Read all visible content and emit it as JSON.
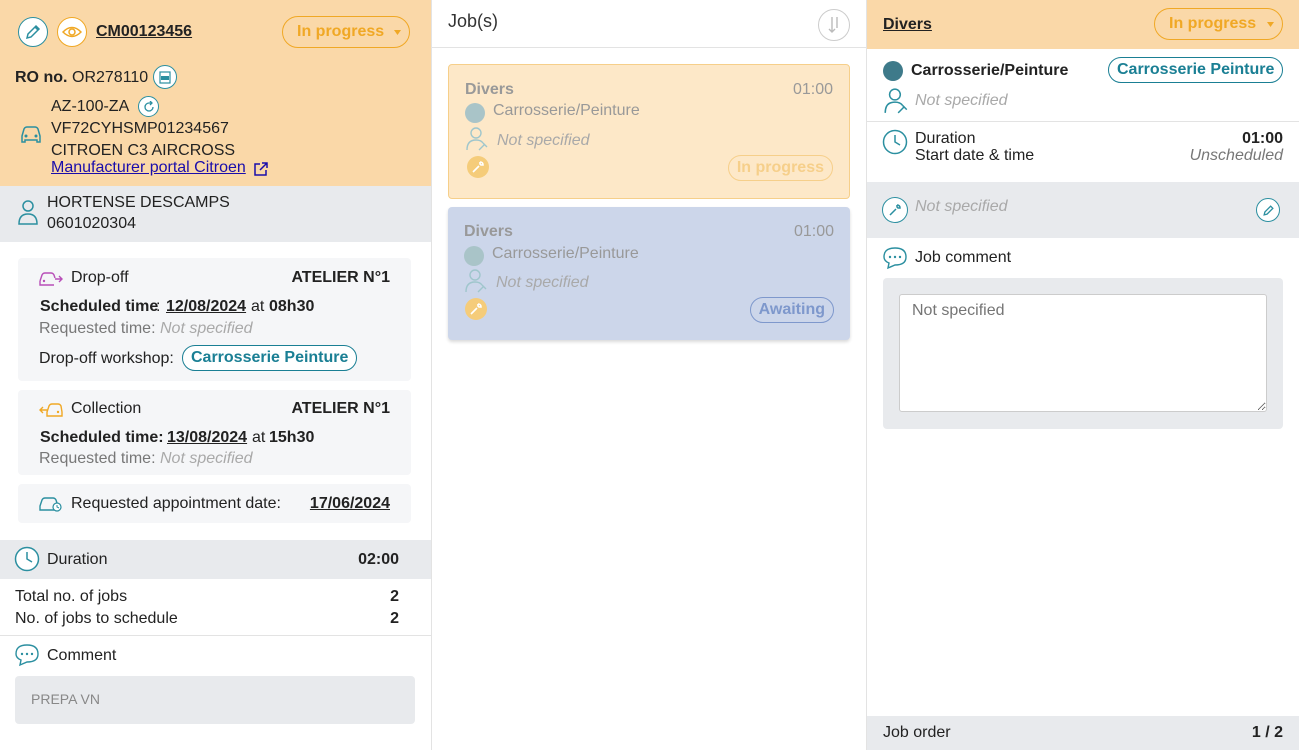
{
  "order": {
    "id": "CM00123456",
    "status": "In progress",
    "ro_label": "RO no.",
    "ro_value": "OR278110",
    "plate": "AZ-100-ZA",
    "vin": "VF72CYHSMP01234567",
    "model": "CITROEN C3 AIRCROSS",
    "portal_link": "Manufacturer portal Citroen"
  },
  "customer": {
    "name": "HORTENSE DESCAMPS",
    "phone": "0601020304"
  },
  "dropoff": {
    "label": "Drop-off",
    "workshop": "ATELIER N°1",
    "scheduled_label": "Scheduled time",
    "scheduled_date": "12/08/2024",
    "at": "at",
    "scheduled_time": "08h30",
    "requested_label": "Requested time:",
    "requested_value": "Not specified",
    "workshop_label": "Drop-off workshop:",
    "workshop_tag": "Carrosserie Peinture"
  },
  "collection": {
    "label": "Collection",
    "workshop": "ATELIER N°1",
    "scheduled_label": "Scheduled time:",
    "scheduled_date": "13/08/2024",
    "at": "at",
    "scheduled_time": "15h30",
    "requested_label": "Requested time:",
    "requested_value": "Not specified"
  },
  "appointment": {
    "label": "Requested appointment date:",
    "date": "17/06/2024"
  },
  "duration": {
    "label": "Duration",
    "value": "02:00"
  },
  "totals": {
    "total_label": "Total no. of jobs",
    "total_value": "2",
    "schedule_label": "No. of jobs to schedule",
    "schedule_value": "2"
  },
  "comment": {
    "label": "Comment",
    "value": "PREPA VN"
  },
  "jobs": {
    "title": "Job(s)",
    "items": [
      {
        "name": "Divers",
        "duration": "01:00",
        "workshop": "Carrosserie/Peinture",
        "tech": "Not specified",
        "status": "In progress"
      },
      {
        "name": "Divers",
        "duration": "01:00",
        "workshop": "Carrosserie/Peinture",
        "tech": "Not specified",
        "status": "Awaiting"
      }
    ]
  },
  "detail": {
    "title": "Divers",
    "status": "In progress",
    "workshop": "Carrosserie/Peinture",
    "workshop_tag": "Carrosserie Peinture",
    "tech": "Not specified",
    "duration_label": "Duration",
    "duration_value": "01:00",
    "start_label": "Start date & time",
    "start_value": "Unscheduled",
    "tool": "Not specified",
    "comment_label": "Job comment",
    "comment_placeholder": "Not specified",
    "order_label": "Job order",
    "order_value": "1 / 2"
  },
  "colors": {
    "accent": "#2b8fa0",
    "orange": "#f0a825",
    "orange_bg": "#fad8a8",
    "awaiting_bg": "#ccd6ea"
  },
  "icons": [
    "pencil-icon",
    "eye-icon",
    "pdf-icon",
    "car-icon",
    "refresh-icon",
    "external-link-icon",
    "person-icon",
    "dropoff-car-icon",
    "collection-car-icon",
    "appointment-car-icon",
    "clock-icon",
    "chat-icon",
    "filter-icon",
    "technician-icon",
    "wrench-icon",
    "caret-down-icon"
  ]
}
